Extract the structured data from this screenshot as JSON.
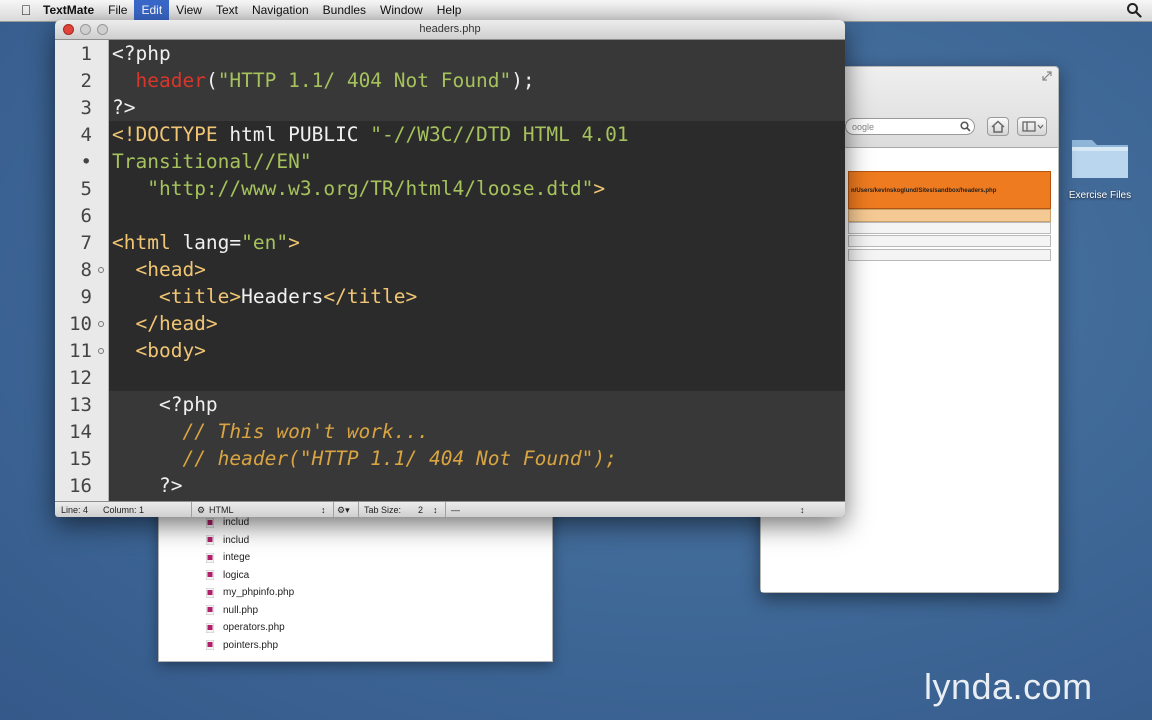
{
  "menubar": {
    "app_name": "TextMate",
    "items": [
      "File",
      "Edit",
      "View",
      "Text",
      "Navigation",
      "Bundles",
      "Window",
      "Help"
    ],
    "active_item": "Edit"
  },
  "editor": {
    "title": "headers.php",
    "line_numbers": [
      "1",
      "2",
      "3",
      "4",
      "•",
      "5",
      "6",
      "7",
      "8",
      "9",
      "10",
      "11",
      "12",
      "13",
      "14",
      "15",
      "16"
    ],
    "status": {
      "line": "Line: 4",
      "column": "Column: 1",
      "language": "HTML",
      "tab_size_label": "Tab Size:",
      "tab_size": "2",
      "symbol": "—"
    }
  },
  "browser": {
    "search_placeholder": "oogle",
    "error_text": "n/Users/kevinskoglund/Sites/sandbox/headers.php"
  },
  "drawer": {
    "files": [
      "includ",
      "includ",
      "intege",
      "logica",
      "my_phpinfo.php",
      "null.php",
      "operators.php",
      "pointers.php"
    ]
  },
  "desktop": {
    "folder_label": "Exercise Files"
  },
  "watermark": "lynda.com",
  "colors": {
    "editor_bg": "#2b2b2b",
    "keyword_red": "#d8362b",
    "string_green": "#a5c25c",
    "tag_yellow": "#f0c674",
    "comment_orange": "#d9a441",
    "error_orange": "#ee7b1f",
    "menu_highlight": "#3a68c9"
  }
}
